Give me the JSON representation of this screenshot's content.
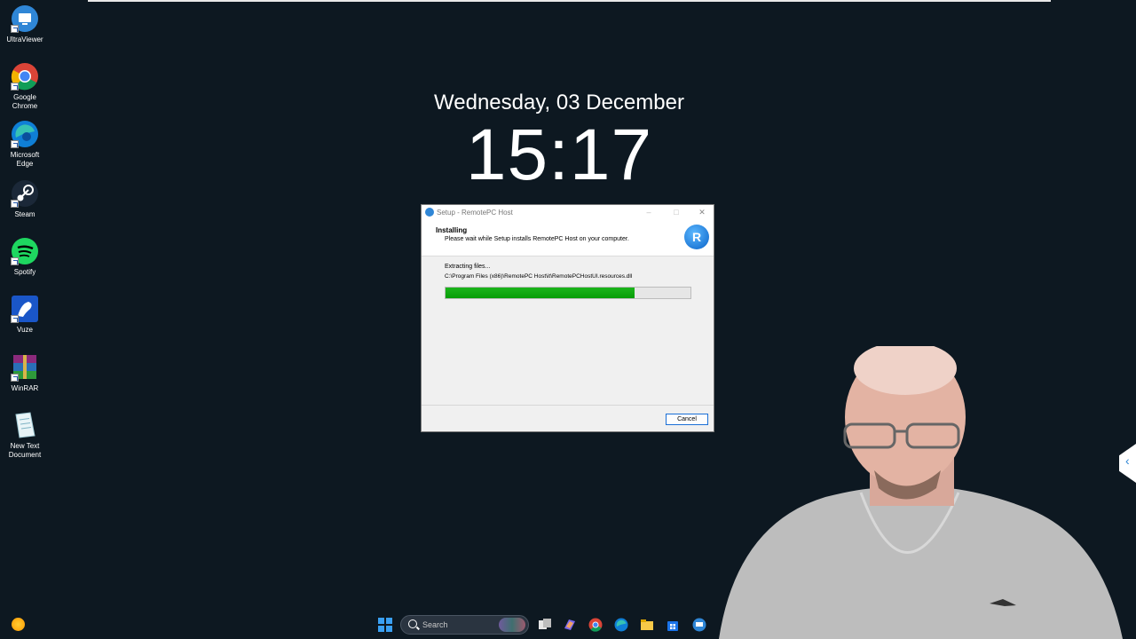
{
  "desktop": {
    "icons": [
      {
        "label": "UltraViewer",
        "icon": "ultraviewer-icon"
      },
      {
        "label": "Google Chrome",
        "icon": "chrome-icon"
      },
      {
        "label": "Microsoft Edge",
        "icon": "edge-icon"
      },
      {
        "label": "Steam",
        "icon": "steam-icon"
      },
      {
        "label": "Spotify",
        "icon": "spotify-icon"
      },
      {
        "label": "Vuze",
        "icon": "vuze-icon"
      },
      {
        "label": "WinRAR",
        "icon": "winrar-icon"
      },
      {
        "label": "New Text Document",
        "icon": "text-document-icon"
      }
    ]
  },
  "lockscreen": {
    "date": "Wednesday, 03 December",
    "time": "15:17"
  },
  "dialog": {
    "title": "Setup - RemotePC Host",
    "heading": "Installing",
    "subheading": "Please wait while Setup installs RemotePC Host on your computer.",
    "status": "Extracting files...",
    "file_path": "C:\\Program Files (x86)\\RemotePC Host\\it\\RemotePCHostUI.resources.dll",
    "progress": 0.77,
    "cancel_label": "Cancel",
    "logo_letter": "R",
    "controls": {
      "minimize": "–",
      "maximize": "□",
      "close": "✕"
    }
  },
  "taskbar": {
    "search_placeholder": "Search",
    "pinned": [
      "task-view-icon",
      "copilot-icon",
      "chrome-icon",
      "edge-icon",
      "file-explorer-icon",
      "store-icon",
      "ultraviewer-icon"
    ]
  },
  "colors": {
    "desktop_bg": "#0d1821",
    "progress_fill": "#12aa12",
    "accent": "#1a6fd6"
  }
}
